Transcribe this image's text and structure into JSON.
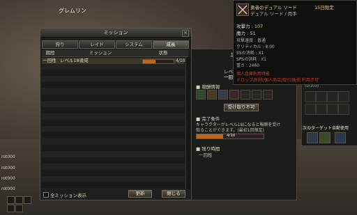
{
  "scene": {
    "npc_name": "グレムリン",
    "left_texts": [
      "rot000",
      "rot000",
      "rot000",
      "rot000"
    ]
  },
  "mission_window": {
    "title": "ミッション",
    "close_glyph": "×",
    "tabs": [
      "狩り",
      "レイド",
      "システム",
      "成長"
    ],
    "active_tab": 3,
    "columns": [
      "期間",
      "ミッション",
      "状態"
    ],
    "rows": [
      {
        "period": "一回性",
        "mission": "レベル18達成",
        "progress_text": "4/10",
        "progress": 0.4
      }
    ],
    "show_all_label": "全ミッション表示",
    "refresh_button": "更新",
    "close_button": "閉じる"
  },
  "detail": {
    "header_clip": "課",
    "level_clip": "レベ",
    "once_clip": "一回",
    "reward_heading": "報酬情報",
    "receive_button": "受け取り不可",
    "complete_heading": "完了条件",
    "complete_text_1": "キャラクターがレベル18になると報酬を受け",
    "complete_text_2": "取ることができます。(最初1回限定)",
    "complete_progress_text": "4/10",
    "complete_progress": 0.4,
    "remaining_heading": "残り時間",
    "remaining_value": "一回性"
  },
  "tooltip": {
    "name": "勇者のデュアル ソード",
    "limit": "15日限定",
    "type": "デュアル ソード / 両手",
    "attack_label": "攻撃力 : ",
    "attack_value": "107",
    "magic_label": "魔力 : ",
    "magic_value": "51",
    "speed": "攻撃速度 : 普通",
    "crit": "クリティカル : 8.00",
    "ss": "SSの消耗 : X1",
    "sps": "SPSの消耗 : X1",
    "weight": "重さ : 2460",
    "bind1": "個人倉庫利用可能",
    "bind2": "ドロップ/削除/個人商店/取引/販売 利用不可"
  },
  "right_panel": {
    "target_label": "次のターゲット自動使用",
    "inv_header": "(0/100)"
  },
  "colors": {
    "accent": "#c0661c",
    "yellow": "#e8d080",
    "red": "#c04030"
  }
}
